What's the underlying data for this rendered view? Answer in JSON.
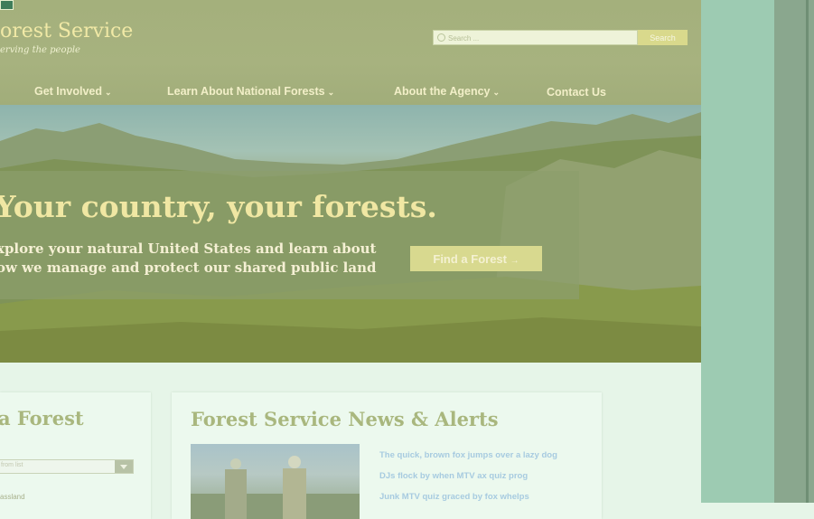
{
  "header": {
    "site_title": "orest Service",
    "tagline": "erving the people",
    "search": {
      "placeholder": "Search ...",
      "button_label": "Search"
    }
  },
  "nav": {
    "items": [
      {
        "label": "Get Involved",
        "has_dropdown": true
      },
      {
        "label": "Learn About National Forests",
        "has_dropdown": true
      },
      {
        "label": "About the Agency",
        "has_dropdown": true
      },
      {
        "label": "Contact Us",
        "has_dropdown": false
      }
    ]
  },
  "hero": {
    "title": "Your country, your forests.",
    "subtitle_line1": "xplore your natural United States and learn about",
    "subtitle_line2": "ow we manage and protect our shared public land",
    "cta_label": "Find a Forest",
    "cta_arrow": "→"
  },
  "find_forest": {
    "title": "a Forest",
    "select_placeholder": "from list",
    "item": "assland"
  },
  "news": {
    "title": "Forest Service News & Alerts",
    "links": [
      "The quick, brown fox jumps over a lazy dog",
      "DJs flock by when MTV ax quiz prog",
      "Junk MTV quiz graced by fox whelps"
    ]
  },
  "icons": {
    "search": "search-icon",
    "dropdown": "chevron-down-icon",
    "arrow": "arrow-right-icon",
    "select": "caret-down-icon"
  },
  "colors": {
    "header_bg": "#a4b07c",
    "accent_button": "#d8d98f",
    "title_text": "#f0e7a3",
    "card_title": "#a9b77e",
    "link": "#a7cbe0"
  }
}
